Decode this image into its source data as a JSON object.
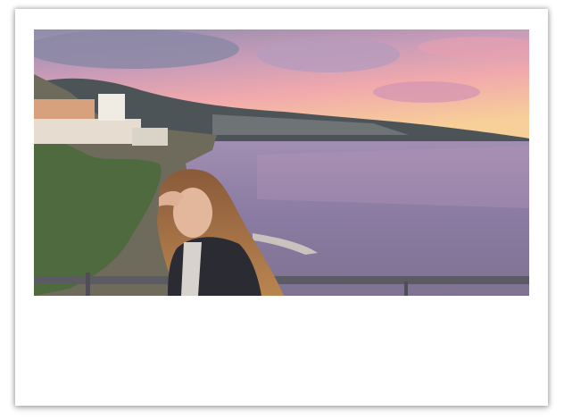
{
  "photo": {
    "subject": "person-at-seaside-cliff-sunset"
  },
  "colors": {
    "card": "#ffffff",
    "sky_top": "#9d8fb6",
    "sky_bottom": "#f6cf9a",
    "sea": "#8f82a6"
  }
}
